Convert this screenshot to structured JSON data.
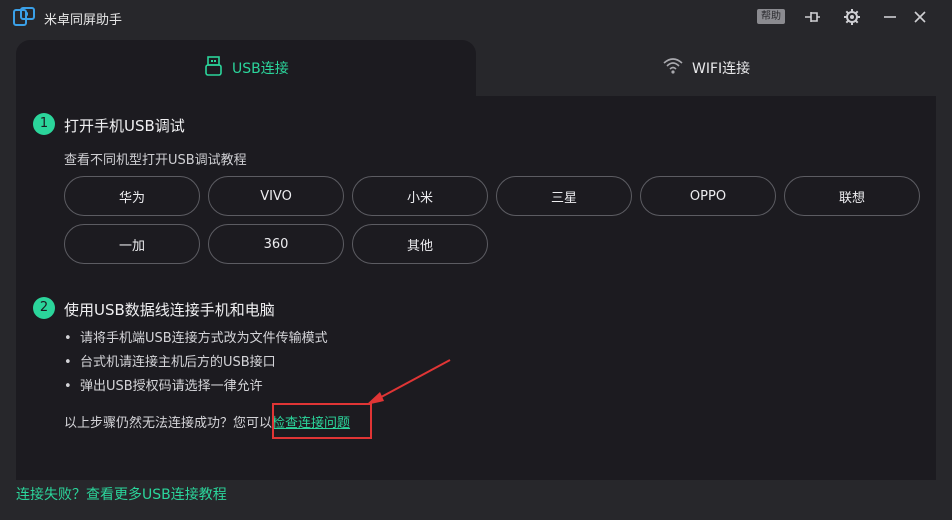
{
  "app": {
    "title": "米卓同屏助手",
    "help_label": "帮助"
  },
  "tabs": [
    {
      "label": "USB连接",
      "icon": "usb-icon",
      "active": true
    },
    {
      "label": "WIFI连接",
      "icon": "wifi-icon",
      "active": false
    }
  ],
  "step1": {
    "number": "1",
    "title": "打开手机USB调试",
    "subtitle": "查看不同机型打开USB调试教程",
    "brands": [
      "华为",
      "VIVO",
      "小米",
      "三星",
      "OPPO",
      "联想",
      "一加",
      "360",
      "其他"
    ]
  },
  "step2": {
    "number": "2",
    "title": "使用USB数据线连接手机和电脑",
    "bullets": [
      "请将手机端USB连接方式改为文件传输模式",
      "台式机请连接主机后方的USB接口",
      "弹出USB授权码请选择一律允许"
    ],
    "prompt_text": "以上步骤仍然无法连接成功？您可以",
    "check_link": "检查连接问题"
  },
  "footer": {
    "link": "连接失败？查看更多USB连接教程"
  },
  "colors": {
    "accent": "#2bd59b",
    "highlight": "#e03535",
    "panel": "#1c1b20",
    "background": "#27272b"
  }
}
